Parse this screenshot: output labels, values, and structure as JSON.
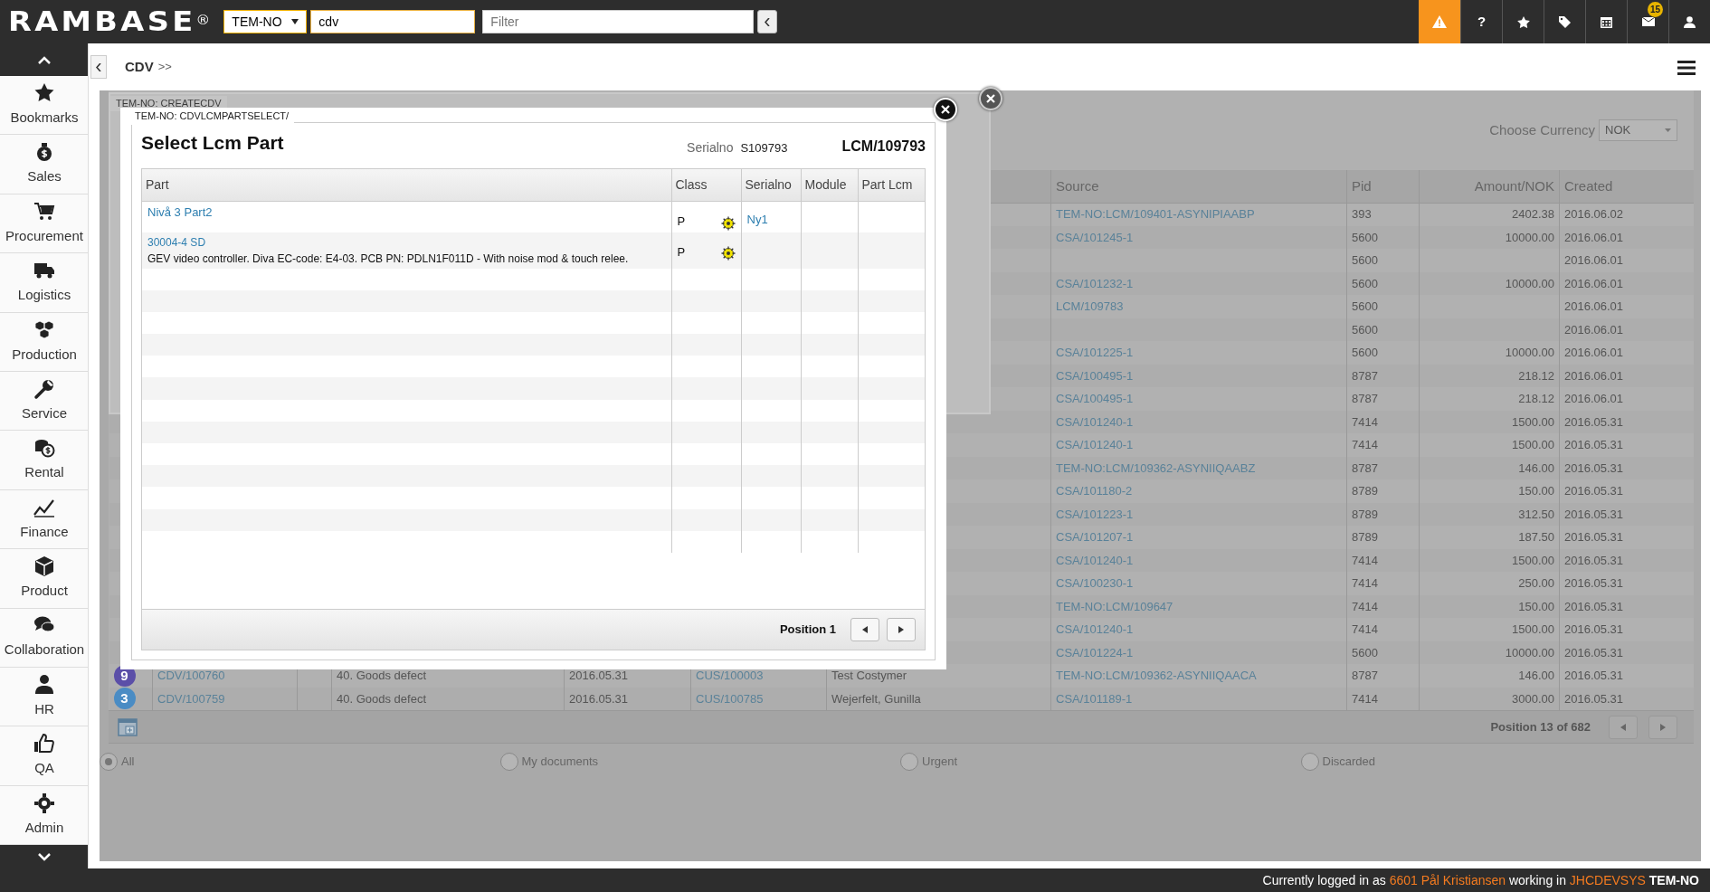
{
  "topbar": {
    "logo": "RAMBASE",
    "logo_mark": "®",
    "company": "TEM-NO",
    "search_value": "cdv",
    "filter_placeholder": "Filter",
    "help_label": "?",
    "mail_count": "15"
  },
  "sidebar": {
    "items": [
      {
        "label": "Bookmarks"
      },
      {
        "label": "Sales"
      },
      {
        "label": "Procurement"
      },
      {
        "label": "Logistics"
      },
      {
        "label": "Production"
      },
      {
        "label": "Service"
      },
      {
        "label": "Rental"
      },
      {
        "label": "Finance"
      },
      {
        "label": "Product"
      },
      {
        "label": "Collaboration"
      },
      {
        "label": "HR"
      },
      {
        "label": "QA"
      },
      {
        "label": "Admin"
      }
    ]
  },
  "breadcrumb": {
    "title": "CDV",
    "separator": ">>"
  },
  "list": {
    "currency_label": "Choose Currency",
    "currency": "NOK",
    "columns": [
      "Source",
      "Pid",
      "Amount/NOK",
      "Created"
    ],
    "rows": [
      {
        "source": "TEM-NO:LCM/109401-ASYNIPIAABP",
        "pid": "393",
        "amount": "2402.38",
        "created": "2016.06.02"
      },
      {
        "source": "CSA/101245-1",
        "pid": "5600",
        "amount": "10000.00",
        "created": "2016.06.01"
      },
      {
        "pid": "5600",
        "created": "2016.06.01"
      },
      {
        "source": "CSA/101232-1",
        "pid": "5600",
        "amount": "10000.00",
        "created": "2016.06.01"
      },
      {
        "source": "LCM/109783",
        "pid": "5600",
        "created": "2016.06.01"
      },
      {
        "pid": "5600",
        "created": "2016.06.01"
      },
      {
        "source": "CSA/101225-1",
        "pid": "5600",
        "amount": "10000.00",
        "created": "2016.06.01"
      },
      {
        "source": "CSA/100495-1",
        "pid": "8787",
        "amount": "218.12",
        "created": "2016.06.01"
      },
      {
        "source": "CSA/100495-1",
        "pid": "8787",
        "amount": "218.12",
        "created": "2016.06.01"
      },
      {
        "source": "CSA/101240-1",
        "pid": "7414",
        "amount": "1500.00",
        "created": "2016.05.31"
      },
      {
        "source": "CSA/101240-1",
        "pid": "7414",
        "amount": "1500.00",
        "created": "2016.05.31"
      },
      {
        "source": "TEM-NO:LCM/109362-ASYNIIQAABZ",
        "pid": "8787",
        "amount": "146.00",
        "created": "2016.05.31"
      },
      {
        "source": "CSA/101180-2",
        "pid": "8789",
        "amount": "150.00",
        "created": "2016.05.31"
      },
      {
        "source": "CSA/101223-1",
        "pid": "8789",
        "amount": "312.50",
        "created": "2016.05.31"
      },
      {
        "source": "CSA/101207-1",
        "pid": "8789",
        "amount": "187.50",
        "created": "2016.05.31"
      },
      {
        "source": "CSA/101240-1",
        "pid": "7414",
        "amount": "1500.00",
        "created": "2016.05.31"
      },
      {
        "source": "CSA/100230-1",
        "pid": "7414",
        "amount": "250.00",
        "created": "2016.05.31"
      },
      {
        "source": "TEM-NO:LCM/109647",
        "pid": "7414",
        "amount": "150.00",
        "created": "2016.05.31"
      },
      {
        "source": "CSA/101240-1",
        "pid": "7414",
        "amount": "1500.00",
        "created": "2016.05.31"
      },
      {
        "source": "CSA/101224-1",
        "pid": "5600",
        "amount": "10000.00",
        "created": "2016.05.31"
      },
      {
        "status": "9",
        "color": "#5b4fa8",
        "doc": "CDV/100760",
        "reason": "40. Goods defect",
        "date": "2016.05.31",
        "customer": "CUS/100003",
        "customer_name": "Test Costymer",
        "source": "TEM-NO:LCM/109362-ASYNIIQAACA",
        "pid": "8787",
        "amount": "146.00",
        "created": "2016.05.31"
      },
      {
        "status": "3",
        "color": "#4a8cc4",
        "doc": "CDV/100759",
        "reason": "40. Goods defect",
        "date": "2016.05.31",
        "customer": "CUS/100785",
        "customer_name": "Wejerfelt, Gunilla",
        "source": "CSA/101189-1",
        "pid": "7414",
        "amount": "3000.00",
        "created": "2016.05.31"
      }
    ],
    "position": "Position 13 of 682",
    "filters": [
      {
        "label": "All",
        "selected": true
      },
      {
        "label": "My documents",
        "selected": false
      },
      {
        "label": "Urgent",
        "selected": false
      },
      {
        "label": "Discarded",
        "selected": false
      }
    ]
  },
  "create_dialog": {
    "tab": "TEM-NO: CREATECDV"
  },
  "part_dialog": {
    "tab": "TEM-NO: CDVLCMPARTSELECT/",
    "title": "Select Lcm Part",
    "serialno_label": "Serialno",
    "serialno": "S109793",
    "document": "LCM/109793",
    "columns": [
      "Part",
      "Class",
      "Serialno",
      "Module",
      "Part Lcm"
    ],
    "rows": [
      {
        "part": "Nivå 3 Part2",
        "class": "P",
        "serialno": "Ny1"
      },
      {
        "part": "30004-4 SD",
        "description": "GEV video controller. Diva EC-code: E4-03. PCB PN: PDLN1F011D - With noise mod & touch relee.",
        "class": "P"
      }
    ],
    "position": "Position 1"
  },
  "status_bar": {
    "prefix": "Currently logged in as",
    "user": "6601 Pål Kristiansen",
    "middle": "working in",
    "system": "JHCDEVSYS",
    "company": "TEM-NO"
  }
}
